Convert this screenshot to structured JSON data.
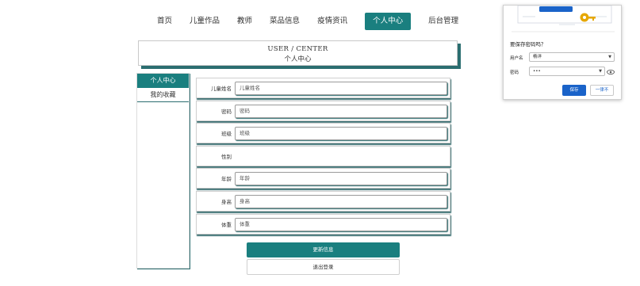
{
  "nav": {
    "items": [
      {
        "label": "首页"
      },
      {
        "label": "儿童作品"
      },
      {
        "label": "教师"
      },
      {
        "label": "菜品信息"
      },
      {
        "label": "疫情资讯"
      },
      {
        "label": "个人中心",
        "active": true
      },
      {
        "label": "后台管理"
      }
    ]
  },
  "banner": {
    "en": "USER / CENTER",
    "cn": "个人中心"
  },
  "sidebar": {
    "items": [
      {
        "label": "个人中心"
      },
      {
        "label": "我的收藏"
      }
    ]
  },
  "form": {
    "fields": [
      {
        "label": "儿童姓名",
        "placeholder": "儿童姓名"
      },
      {
        "label": "密码",
        "placeholder": "密码"
      },
      {
        "label": "班级",
        "placeholder": "班级"
      },
      {
        "label": "性别",
        "placeholder": ""
      },
      {
        "label": "年龄",
        "placeholder": "年龄"
      },
      {
        "label": "身高",
        "placeholder": "身高"
      },
      {
        "label": "体重",
        "placeholder": "体重"
      }
    ],
    "update_label": "更新信息",
    "logout_label": "退出登录"
  },
  "popup": {
    "title": "要保存密码吗？",
    "username_label": "用户名",
    "username_value": "杨洋",
    "password_label": "密码",
    "password_value": "•••",
    "save_label": "保存",
    "never_label": "一律不",
    "colors": {
      "primary": "#1a63c9",
      "accent": "#e6a700"
    }
  },
  "colors": {
    "brand": "#1a7f7f",
    "shadow": "#2b6e70"
  }
}
